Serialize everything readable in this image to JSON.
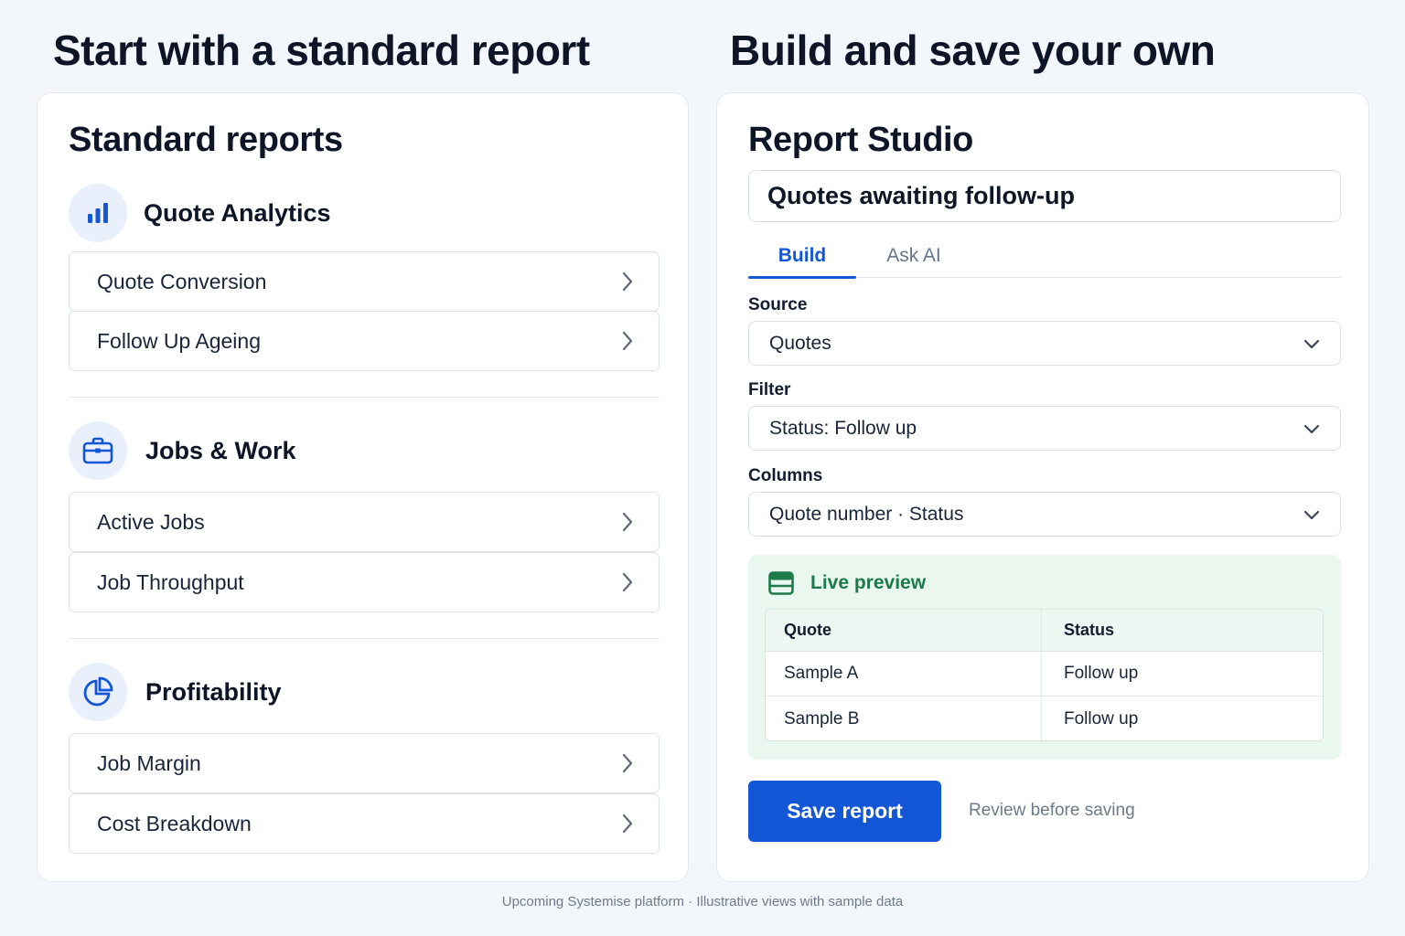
{
  "headlines": {
    "left": "Start with a standard report",
    "right": "Build and save your own"
  },
  "standard_reports": {
    "title": "Standard reports",
    "sections": [
      {
        "label": "Quote Analytics",
        "icon": "bar-chart-icon",
        "items": [
          "Quote Conversion",
          "Follow Up Ageing"
        ]
      },
      {
        "label": "Jobs & Work",
        "icon": "briefcase-icon",
        "items": [
          "Active Jobs",
          "Job Throughput"
        ]
      },
      {
        "label": "Profitability",
        "icon": "pie-chart-icon",
        "items": [
          "Job Margin",
          "Cost Breakdown"
        ]
      }
    ]
  },
  "studio": {
    "title": "Report Studio",
    "report_name": "Quotes awaiting follow-up",
    "tabs": [
      {
        "label": "Build",
        "active": true
      },
      {
        "label": "Ask AI",
        "active": false
      }
    ],
    "fields": [
      {
        "label": "Source",
        "value": "Quotes"
      },
      {
        "label": "Filter",
        "value": "Status: Follow up"
      },
      {
        "label": "Columns",
        "value": "Quote number · Status"
      }
    ],
    "preview": {
      "title": "Live preview",
      "icon": "table-icon",
      "columns": [
        "Quote",
        "Status"
      ],
      "rows": [
        [
          "Sample A",
          "Follow up"
        ],
        [
          "Sample B",
          "Follow up"
        ]
      ]
    },
    "save_label": "Save report",
    "hint": "Review before saving"
  },
  "footer": "Upcoming Systemise platform · Illustrative views with sample data",
  "colors": {
    "accent": "#1356d6",
    "preview_bg": "#e9f7ef",
    "preview_text": "#1d7a4a",
    "icon_bg": "#e9f0fb"
  }
}
